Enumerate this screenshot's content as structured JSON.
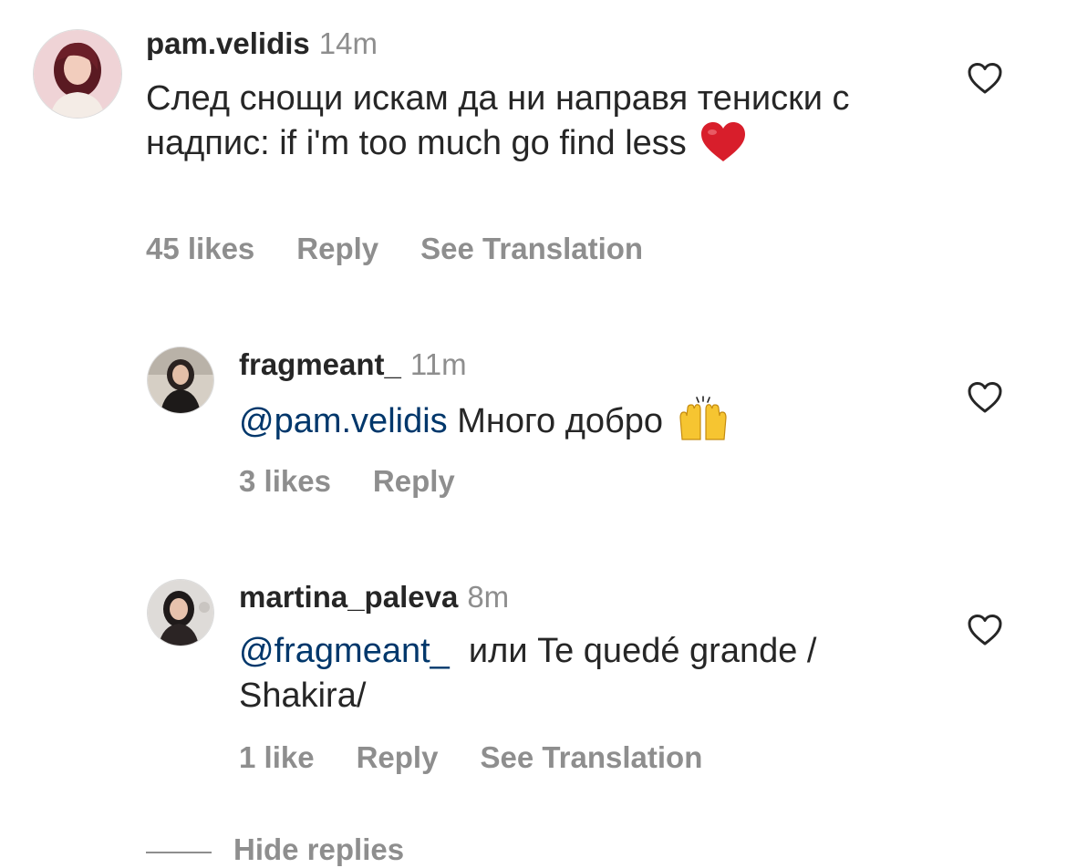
{
  "comments": [
    {
      "username": "pam.velidis",
      "time": "14m",
      "text": "След снощи искам да ни направя тениски с надпис: if i'm too much go find less",
      "emoji": "red-heart",
      "likes": "45 likes",
      "reply": "Reply",
      "translate": "See Translation",
      "avatar_bg": "#e9c8cc"
    },
    {
      "username": "fragmeant_",
      "time": "11m",
      "mention": "@pam.velidis",
      "text": " Много добро",
      "emoji": "raising-hands",
      "likes": "3 likes",
      "reply": "Reply",
      "avatar_bg": "#cfcac2"
    },
    {
      "username": "martina_paleva",
      "time": "8m",
      "mention": "@fragmeant_",
      "text": "  или Te quedé grande / Shakira/",
      "likes": "1 like",
      "reply": "Reply",
      "translate": "See Translation",
      "avatar_bg": "#d9d6d3"
    }
  ],
  "hide_replies": "Hide replies",
  "colors": {
    "text": "#262626",
    "secondary": "#8e8e8e",
    "mention": "#00376b",
    "heart": "#d81e2b"
  }
}
